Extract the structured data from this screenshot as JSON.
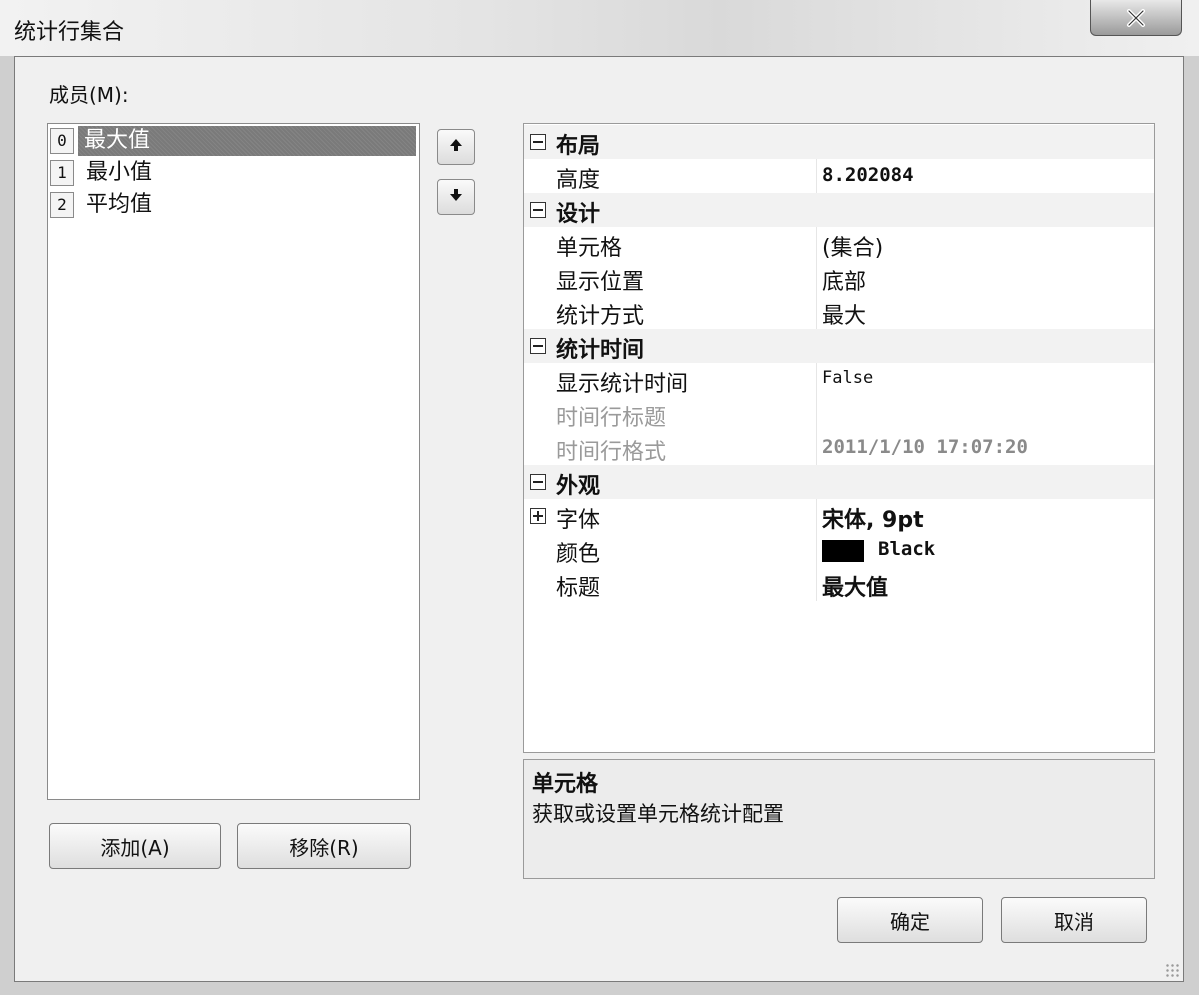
{
  "window": {
    "title": "统计行集合"
  },
  "members": {
    "label": "成员(M):",
    "items": [
      {
        "index": "0",
        "name": "最大值",
        "selected": true
      },
      {
        "index": "1",
        "name": "最小值",
        "selected": false
      },
      {
        "index": "2",
        "name": "平均值",
        "selected": false
      }
    ]
  },
  "buttons": {
    "add": "添加(A)",
    "remove": "移除(R)",
    "ok": "确定",
    "cancel": "取消"
  },
  "properties": {
    "layout": {
      "category": "布局",
      "height_name": "高度",
      "height_value": "8.202084"
    },
    "design": {
      "category": "设计",
      "cells_name": "单元格",
      "cells_value": "(集合)",
      "position_name": "显示位置",
      "position_value": "底部",
      "method_name": "统计方式",
      "method_value": "最大"
    },
    "time": {
      "category": "统计时间",
      "show_time_name": "显示统计时间",
      "show_time_value": "False",
      "time_title_name": "时间行标题",
      "time_title_value": "",
      "time_format_name": "时间行格式",
      "time_format_value": "2011/1/10 17:07:20"
    },
    "appearance": {
      "category": "外观",
      "font_name": "字体",
      "font_value": "宋体, 9pt",
      "color_name": "颜色",
      "color_value": "Black",
      "color_hex": "#000000",
      "caption_name": "标题",
      "caption_value": "最大值"
    }
  },
  "description": {
    "title": "单元格",
    "text": "获取或设置单元格统计配置"
  },
  "icons": {
    "close": "close-icon",
    "up": "arrow-up-icon",
    "down": "arrow-down-icon"
  }
}
